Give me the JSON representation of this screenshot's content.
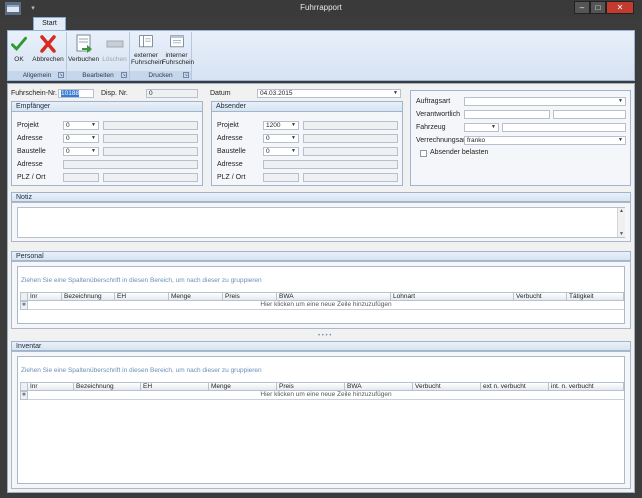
{
  "window": {
    "title": "Fuhrrapport"
  },
  "ribbon": {
    "tab": "Start",
    "groups": {
      "allgemein": {
        "label": "Allgemein",
        "ok": "OK",
        "abbrechen": "Abbrechen"
      },
      "bearbeiten": {
        "label": "Bearbeiten",
        "verbuchen": "Verbuchen",
        "loeschen": "Löschen"
      },
      "drucken": {
        "label": "Drucken",
        "extern_l1": "externer",
        "extern_l2": "Fuhrschein",
        "intern_l1": "interner",
        "intern_l2": "Fuhrschein"
      }
    }
  },
  "header": {
    "fuhrschein_label": "Fuhrschein-Nr.",
    "fuhrschein_value": "10188",
    "disp_label": "Disp. Nr.",
    "disp_value": "0",
    "datum_label": "Datum",
    "datum_value": "04.03.2015"
  },
  "empfaenger": {
    "title": "Empfänger",
    "projekt_label": "Projekt",
    "projekt_value": "0",
    "adresse_label": "Adresse",
    "adresse_value": "0",
    "baustelle_label": "Baustelle",
    "baustelle_value": "0",
    "adresse2_label": "Adresse",
    "plz_label": "PLZ / Ort"
  },
  "absender": {
    "title": "Absender",
    "projekt_label": "Projekt",
    "projekt_value": "1200",
    "adresse_label": "Adresse",
    "adresse_value": "0",
    "baustelle_label": "Baustelle",
    "baustelle_value": "0",
    "adresse2_label": "Adresse",
    "plz_label": "PLZ / Ort"
  },
  "auftrag": {
    "auftragsart_label": "Auftragsart",
    "verantwortlich_label": "Verantwortlich",
    "fahrzeug_label": "Fahrzeug",
    "verrechnungsart_label": "Verrechnungsart",
    "verrechnungsart_value": "franko",
    "absender_belasten_label": "Absender belasten"
  },
  "notiz": {
    "title": "Notiz"
  },
  "personal": {
    "title": "Personal",
    "group_hint": "Ziehen Sie eine Spaltenüberschrift in diesen Bereich, um nach dieser zu gruppieren",
    "columns": [
      "Inr",
      "Bezeichnung",
      "EH",
      "Menge",
      "Preis",
      "BWA",
      "Lohnart",
      "Verbucht",
      "Tätigkeit"
    ],
    "new_row": "Hier klicken um eine neue Zeile hinzuzufügen"
  },
  "inventar": {
    "title": "Inventar",
    "group_hint": "Ziehen Sie eine Spaltenüberschrift in diesen Bereich, um nach dieser zu gruppieren",
    "columns": [
      "Inr",
      "Bezeichnung",
      "EH",
      "Menge",
      "Preis",
      "BWA",
      "Verbucht",
      "ext n. verbucht",
      "int. n. verbucht"
    ],
    "new_row": "Hier klicken um eine neue Zeile hinzuzufügen"
  }
}
